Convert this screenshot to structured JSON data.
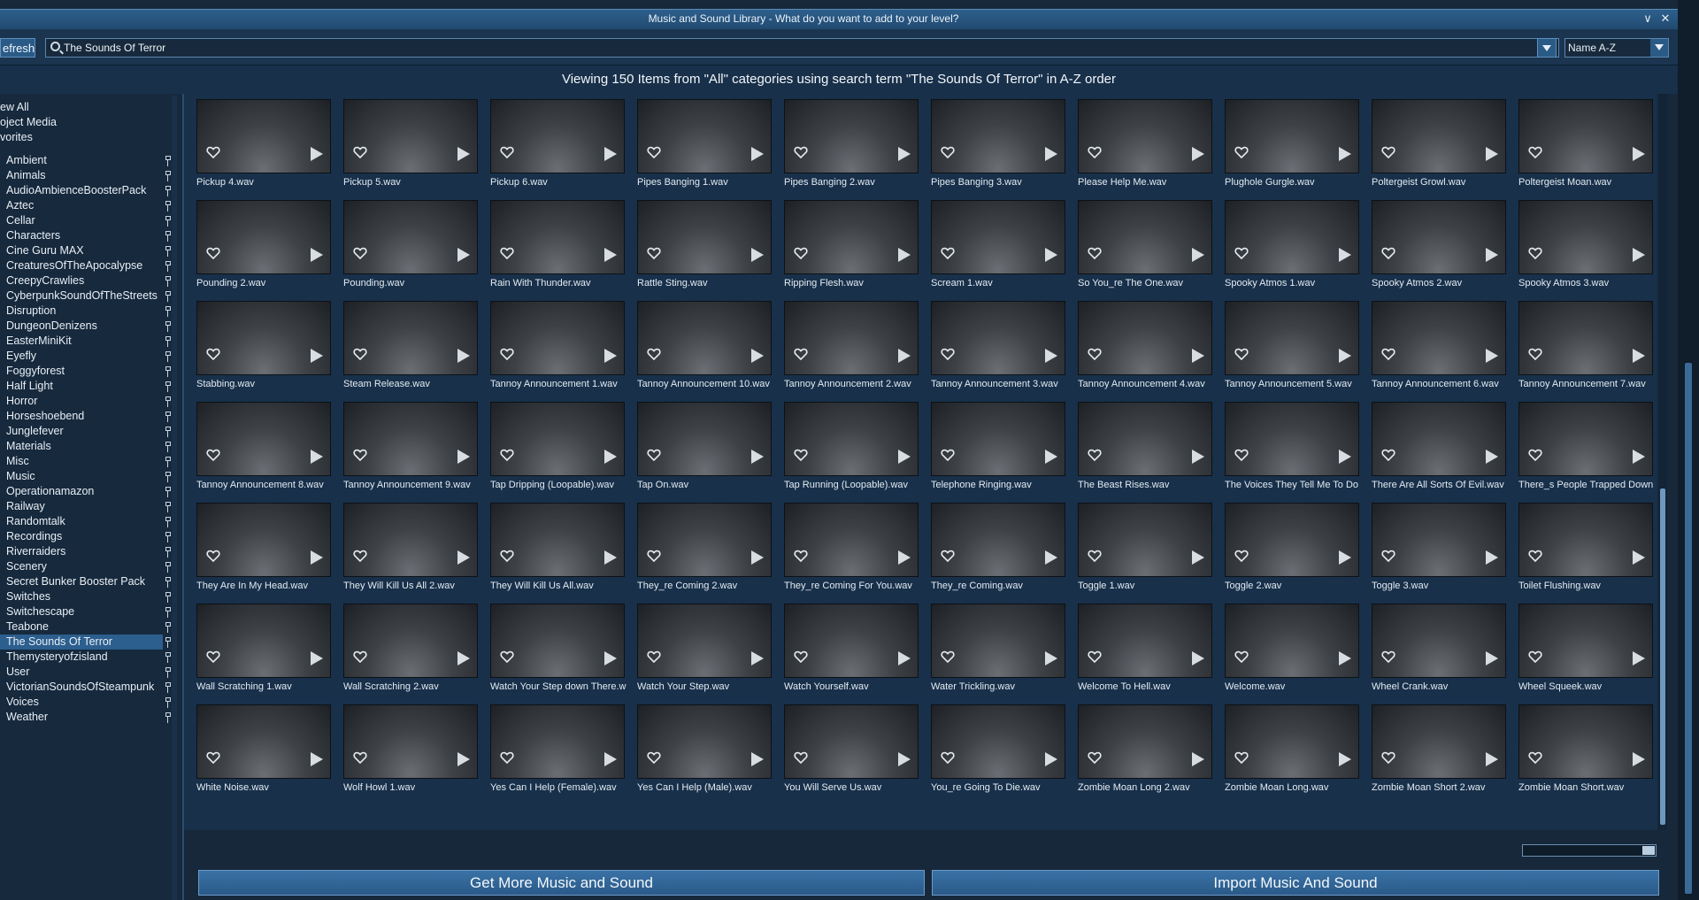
{
  "window": {
    "title": "Music and Sound Library - What do you want to add to your level?",
    "collapse_icon": "chevron-down-icon",
    "close_icon": "close-icon"
  },
  "toolbar": {
    "refresh_label": "efresh",
    "search_value": "The Sounds Of Terror",
    "sort_value": "Name A-Z"
  },
  "status": {
    "text": "Viewing 150 Items from \"All\" categories using search term \"The Sounds Of Terror\" in A-Z order"
  },
  "sidebar": {
    "top_items": [
      "ew All",
      "oject Media",
      "vorites"
    ],
    "categories": [
      "Ambient",
      "Animals",
      "AudioAmbienceBoosterPack",
      "Aztec",
      "Cellar",
      "Characters",
      "Cine Guru MAX",
      "CreaturesOfTheApocalypse",
      "CreepyCrawlies",
      "CyberpunkSoundOfTheStreets",
      "Disruption",
      "DungeonDenizens",
      "EasterMiniKit",
      "Eyefly",
      "Foggyforest",
      "Half Light",
      "Horror",
      "Horseshoebend",
      "Junglefever",
      "Materials",
      "Misc",
      "Music",
      "Operationamazon",
      "Railway",
      "Randomtalk",
      "Recordings",
      "Riverraiders",
      "Scenery",
      "Secret Bunker Booster Pack",
      "Switches",
      "Switchescape",
      "Teabone",
      "The Sounds Of Terror",
      "Themysteryofzisland",
      "User",
      "VictorianSoundsOfSteampunk",
      "Voices",
      "Weather"
    ],
    "selected": "The Sounds Of Terror"
  },
  "items": [
    "Pickup 4.wav",
    "Pickup 5.wav",
    "Pickup 6.wav",
    "Pipes Banging 1.wav",
    "Pipes Banging 2.wav",
    "Pipes Banging 3.wav",
    "Please Help Me.wav",
    "Plughole Gurgle.wav",
    "Poltergeist Growl.wav",
    "Poltergeist Moan.wav",
    "Pounding 2.wav",
    "Pounding.wav",
    "Rain With Thunder.wav",
    "Rattle Sting.wav",
    "Ripping Flesh.wav",
    "Scream 1.wav",
    "So You_re The One.wav",
    "Spooky Atmos 1.wav",
    "Spooky Atmos 2.wav",
    "Spooky Atmos 3.wav",
    "Stabbing.wav",
    "Steam Release.wav",
    "Tannoy Announcement 1.wav",
    "Tannoy Announcement 10.wav",
    "Tannoy Announcement 2.wav",
    "Tannoy Announcement 3.wav",
    "Tannoy Announcement 4.wav",
    "Tannoy Announcement 5.wav",
    "Tannoy Announcement 6.wav",
    "Tannoy Announcement 7.wav",
    "Tannoy Announcement 8.wav",
    "Tannoy Announcement 9.wav",
    "Tap Dripping (Loopable).wav",
    "Tap On.wav",
    "Tap Running (Loopable).wav",
    "Telephone Ringing.wav",
    "The Beast Rises.wav",
    "The Voices They Tell Me To Do",
    "There Are All Sorts Of Evil.wav",
    "There_s People Trapped Down",
    "They Are In My Head.wav",
    "They Will Kill Us All 2.wav",
    "They Will Kill Us All.wav",
    "They_re Coming 2.wav",
    "They_re Coming For You.wav",
    "They_re Coming.wav",
    "Toggle 1.wav",
    "Toggle 2.wav",
    "Toggle 3.wav",
    "Toilet Flushing.wav",
    "Wall Scratching 1.wav",
    "Wall Scratching 2.wav",
    "Watch Your Step down There.w",
    "Watch Your Step.wav",
    "Watch Yourself.wav",
    "Water Trickling.wav",
    "Welcome To Hell.wav",
    "Welcome.wav",
    "Wheel Crank.wav",
    "Wheel Squeek.wav",
    "White Noise.wav",
    "Wolf Howl 1.wav",
    "Yes Can I Help (Female).wav",
    "Yes Can I Help (Male).wav",
    "You Will Serve Us.wav",
    "You_re Going To Die.wav",
    "Zombie Moan Long 2.wav",
    "Zombie Moan Long.wav",
    "Zombie Moan Short 2.wav",
    "Zombie Moan Short.wav"
  ],
  "tile_icons": {
    "favorite": "heart-icon",
    "play": "play-icon"
  },
  "buttons": {
    "get_more": "Get More Music and Sound",
    "import": "Import Music And Sound"
  }
}
